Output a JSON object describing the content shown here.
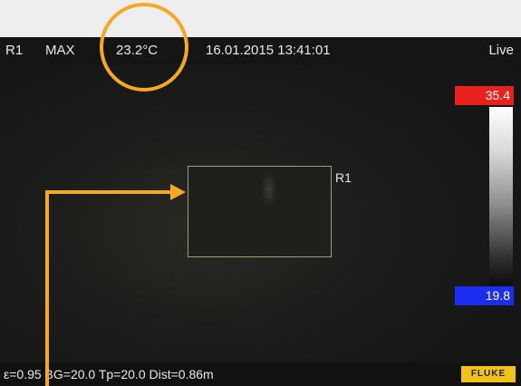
{
  "header": {
    "region": "R1",
    "mode": "MAX",
    "temperature": "23.2°C",
    "datetime": "16.01.2015 13:41:01",
    "status": "Live"
  },
  "roi": {
    "label": "R1"
  },
  "scale": {
    "max": "35.4",
    "min": "19.8"
  },
  "footer": {
    "params": "ε=0.95 BG=20.0 Tp=20.0 Dist=0.86m",
    "brand": "FLUKE"
  },
  "colors": {
    "annotation": "#f7a823",
    "scale_max_bg": "#e8211f",
    "scale_min_bg": "#1d2df0",
    "brand_bg": "#f2c21b",
    "roi_border": "#9aa16a"
  }
}
